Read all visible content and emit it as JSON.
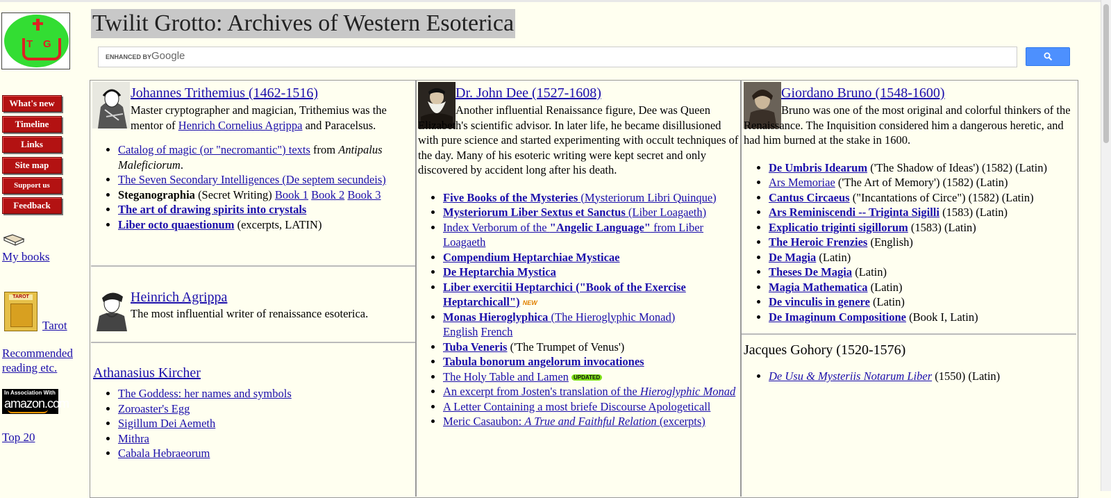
{
  "header": {
    "title": "Twilit Grotto: Archives of Western Esoterica"
  },
  "search": {
    "enhanced_label": "ENHANCED BY",
    "google_label": "Google"
  },
  "sidebar": {
    "logo_letters": [
      "T",
      "G"
    ],
    "nav": [
      "What's new",
      "Timeline",
      "Links",
      "Site map",
      "Support us",
      "Feedback"
    ],
    "my_books": "My books",
    "tarot": "Tarot",
    "tarot_img_text": "TAROT",
    "recommended_1": "Recommended",
    "recommended_2": "reading etc.",
    "amazon_top": "In Association With",
    "amazon_brand": "amazon.com",
    "top20": "Top 20"
  },
  "col1": {
    "trithemius": {
      "name": "Johannes Trithemius (1462-1516)",
      "desc_a": "Master cryptographer and magician, Trithemius was the mentor of ",
      "desc_link": "Henrich Cornelius Agrippa",
      "desc_b": " and Paracelsus.",
      "items": {
        "catalog_link": "Catalog of magic (or \"necromantic\") texts",
        "catalog_from": " from ",
        "catalog_ital": "Antipalus Maleficiorum",
        "catalog_end": ".",
        "seven": "The Seven Secondary Intelligences (De septem secundeis)",
        "steg_bold": "Steganographia",
        "steg_text": " (Secret Writing) ",
        "book1": "Book 1",
        "book2": "Book 2",
        "book3": "Book 3",
        "crystals": "The art of drawing spirits into crystals",
        "liber_octo": "Liber octo quaestionum",
        "liber_octo_note": " (excerpts, LATIN)"
      }
    },
    "agrippa": {
      "name": "Heinrich Agrippa",
      "desc": "The most influential writer of renaissance esoterica."
    },
    "kircher": {
      "name": "Athanasius Kircher",
      "items": [
        "The Goddess: her names and symbols",
        "Zoroaster's Egg",
        "Sigillum Dei Aemeth",
        "Mithra",
        "Cabala Hebraeorum"
      ]
    }
  },
  "col2": {
    "dee": {
      "name": "Dr. John Dee (1527-1608)",
      "desc": "Another influential Renaissance figure, Dee was Queen Elizabeth's scientific advisor. In later life, he became disillusioned with pure science and started experimenting with occult techniques of the day. Many of his esoteric writing were kept secret and only discovered by accident long after his death.",
      "items": {
        "five_bold": "Five Books of the Mysteries ",
        "five_rest": "(Mysteriorum Libri Quinque)",
        "sextus_bold": "Mysteriorum Liber Sextus et Sanctus ",
        "sextus_rest": "(Liber Loagaeth)",
        "index_a": "Index Verborum of the ",
        "index_bold": "\"Angelic Language\"",
        "index_b": " from Liber Loagaeth",
        "compendium": "Compendium Heptarchiae Mysticae",
        "de_hept": "De Heptarchia Mystica",
        "liber_ex": "Liber exercitii Heptarchici (\"Book of the Exercise Heptarchicall\")",
        "new_badge": "NEW",
        "monas_bold": "Monas Hieroglyphica ",
        "monas_rest": "(The Hieroglyphic Monad)",
        "english": "English",
        "french": "French",
        "tuba_bold": "Tuba Veneris",
        "tuba_note": " ('The Trumpet of Venus')",
        "tabula": "Tabula bonorum angelorum invocationes",
        "holy": "The Holy Table and Lamen",
        "updated_badge": "UPDATED",
        "excerpt_a": "An excerpt from Josten's translation of the ",
        "excerpt_ital": "Hieroglyphic Monad",
        "letter": "A Letter Containing a most briefe Discourse Apologeticall",
        "meric_a": "Meric Casaubon: ",
        "meric_ital": "A True and Faithful Relation ",
        "meric_b": "(excerpts)"
      }
    }
  },
  "col3": {
    "bruno": {
      "name": "Giordano Bruno (1548-1600)",
      "desc": "Bruno was one of the most original and colorful thinkers of the Renaissance. The Inquisition considered him a dangerous heretic, and had him burned at the stake in 1600.",
      "items": [
        {
          "link": "De Umbris Idearum",
          "bold": true,
          "note": " ('The Shadow of Ideas') (1582) (Latin)"
        },
        {
          "link": "Ars Memoriae",
          "bold": false,
          "note": " ('The Art of Memory') (1582) (Latin)"
        },
        {
          "link": "Cantus Circaeus",
          "bold": true,
          "note": " (\"Incantations of Circe\") (1582) (Latin)"
        },
        {
          "link": "Ars Reminiscendi -- Triginta Sigilli",
          "bold": true,
          "note": " (1583) (Latin)"
        },
        {
          "link": "Explicatio triginti sigillorum",
          "bold": true,
          "note": " (1583) (Latin)"
        },
        {
          "link": "The Heroic Frenzies",
          "bold": true,
          "note": " (English)"
        },
        {
          "link": "De Magia",
          "bold": true,
          "note": " (Latin)"
        },
        {
          "link": "Theses De Magia",
          "bold": true,
          "note": " (Latin)"
        },
        {
          "link": "Magia Mathematica",
          "bold": true,
          "note": " (Latin)"
        },
        {
          "link": "De vinculis in genere",
          "bold": true,
          "note": " (Latin)"
        },
        {
          "link": "De Imaginum Compositione",
          "bold": true,
          "note": " (Book I, Latin)"
        }
      ]
    },
    "gohory": {
      "name": "Jacques Gohory (1520-1576)",
      "item_link": "De Usu & Mysteriis Notarum Liber",
      "item_note": " (1550) (Latin)"
    }
  }
}
